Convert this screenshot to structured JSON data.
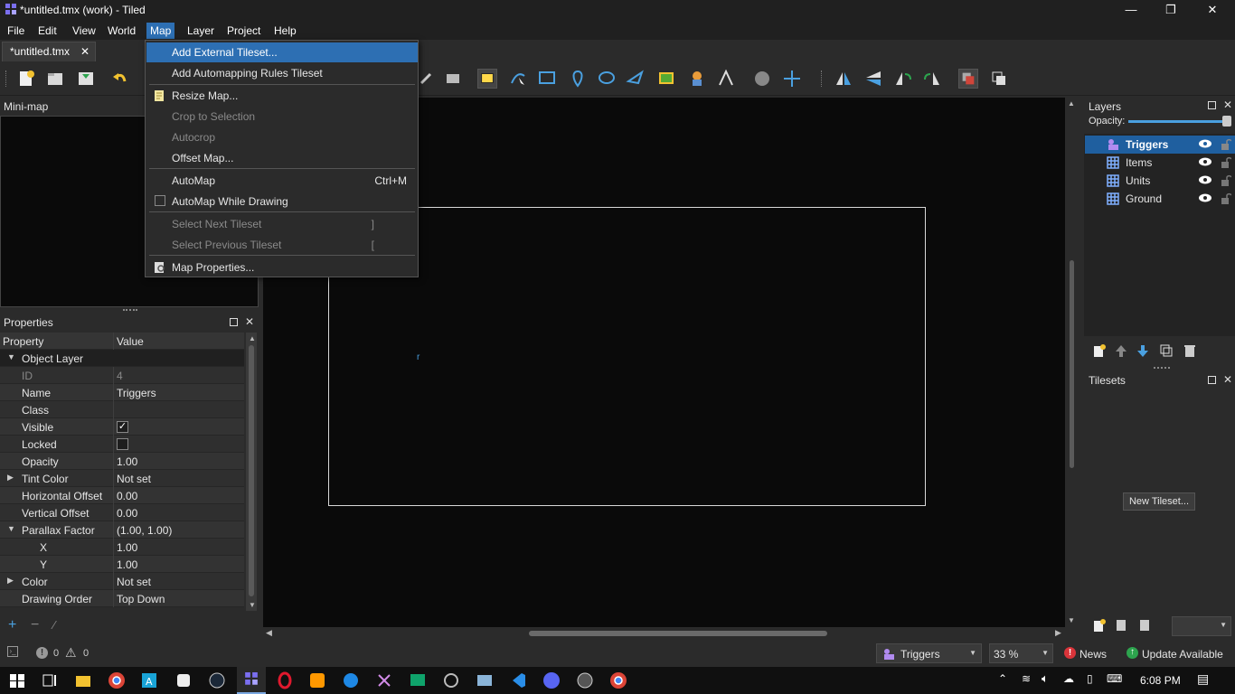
{
  "window": {
    "title": "*untitled.tmx (work) - Tiled",
    "minimize": "—",
    "restore": "❐",
    "close": "✕"
  },
  "menubar": {
    "items": [
      "File",
      "Edit",
      "View",
      "World",
      "Map",
      "Layer",
      "Project",
      "Help"
    ],
    "active": "Map"
  },
  "tabs": [
    {
      "label": "*untitled.tmx",
      "close": "✕"
    }
  ],
  "map_menu": {
    "items": [
      {
        "label": "Add External Tileset...",
        "state": "highlighted"
      },
      {
        "label": "Add Automapping Rules Tileset",
        "state": "normal"
      },
      {
        "label": "Resize Map...",
        "state": "normal",
        "icon": "resize-icon"
      },
      {
        "label": "Crop to Selection",
        "state": "disabled"
      },
      {
        "label": "Autocrop",
        "state": "disabled"
      },
      {
        "label": "Offset Map...",
        "state": "normal"
      },
      {
        "label": "AutoMap",
        "shortcut": "Ctrl+M",
        "state": "normal"
      },
      {
        "label": "AutoMap While Drawing",
        "state": "checkbox-unchecked"
      },
      {
        "label": "Select Next Tileset",
        "shortcut": "]",
        "state": "disabled"
      },
      {
        "label": "Select Previous Tileset",
        "shortcut": "[",
        "state": "disabled"
      },
      {
        "label": "Map Properties...",
        "state": "normal",
        "icon": "properties-icon"
      }
    ]
  },
  "minimap": {
    "title": "Mini-map"
  },
  "properties": {
    "title": "Properties",
    "header": {
      "property": "Property",
      "value": "Value"
    },
    "group": "Object Layer",
    "rows": [
      {
        "name": "ID",
        "value": "4",
        "disabled": true
      },
      {
        "name": "Name",
        "value": "Triggers"
      },
      {
        "name": "Class",
        "value": ""
      },
      {
        "name": "Visible",
        "value": "✓",
        "checkbox": true,
        "checked": true
      },
      {
        "name": "Locked",
        "value": "",
        "checkbox": true,
        "checked": false
      },
      {
        "name": "Opacity",
        "value": "1.00"
      },
      {
        "name": "Tint Color",
        "value": "Not set",
        "expandable": true
      },
      {
        "name": "Horizontal Offset",
        "value": "0.00"
      },
      {
        "name": "Vertical Offset",
        "value": "0.00"
      },
      {
        "name": "Parallax Factor",
        "value": "(1.00, 1.00)",
        "expanded": true
      },
      {
        "name": "X",
        "value": "1.00",
        "child": true
      },
      {
        "name": "Y",
        "value": "1.00",
        "child": true
      },
      {
        "name": "Color",
        "value": "Not set",
        "expandable": true
      },
      {
        "name": "Drawing Order",
        "value": "Top Down"
      }
    ]
  },
  "layers": {
    "title": "Layers",
    "opacity_label": "Opacity:",
    "opacity": 1.0,
    "items": [
      {
        "name": "Triggers",
        "type": "object-layer-icon",
        "selected": true
      },
      {
        "name": "Items",
        "type": "tile-layer-icon",
        "selected": false
      },
      {
        "name": "Units",
        "type": "tile-layer-icon",
        "selected": false
      },
      {
        "name": "Ground",
        "type": "tile-layer-icon",
        "selected": false
      }
    ]
  },
  "tilesets": {
    "title": "Tilesets",
    "new_button": "New Tileset..."
  },
  "statusbar": {
    "errors": "0",
    "warnings": "0",
    "layer_combo": "Triggers",
    "zoom": "33 %",
    "news": "News",
    "update": "Update Available"
  },
  "taskbar": {
    "time": "6:08 PM"
  },
  "colors": {
    "accent": "#2d6fb3",
    "selection": "#1f5f9f",
    "canvas": "#0a0a0a"
  }
}
